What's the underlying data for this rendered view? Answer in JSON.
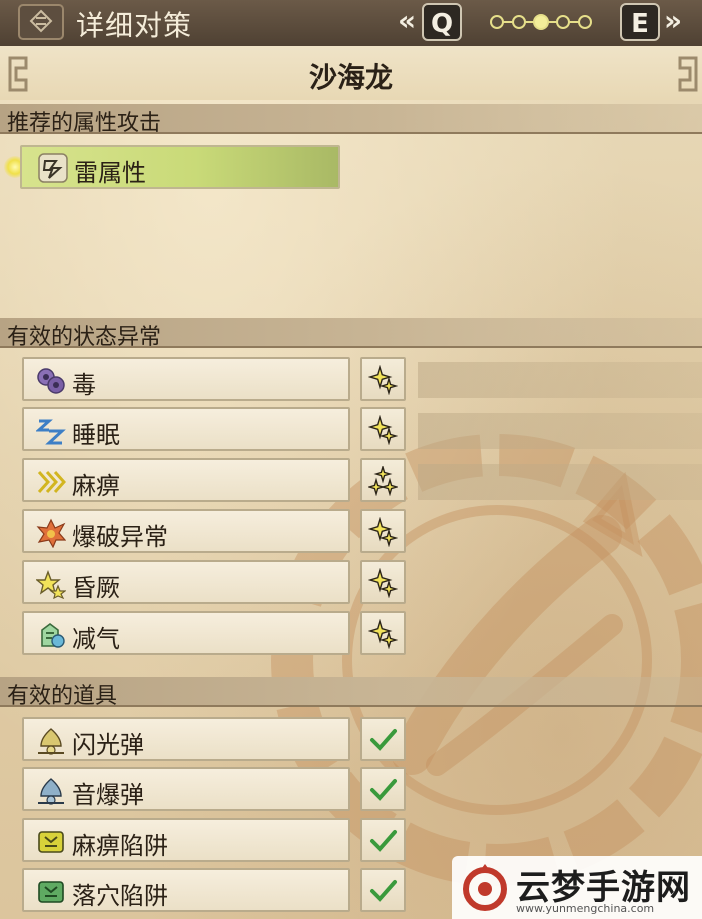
{
  "header": {
    "title": "详细对策",
    "prev_key": "Q",
    "next_key": "E",
    "prev_chevron": "«",
    "next_chevron": "»",
    "page_dots": {
      "count": 5,
      "active_index": 2
    }
  },
  "monster_name": "沙海龙",
  "recommended": {
    "section_title": "推荐的属性攻击",
    "items": [
      {
        "label": "雷属性",
        "icon": "thunder-element-icon"
      }
    ]
  },
  "ailments": {
    "section_title": "有效的状态异常",
    "items": [
      {
        "label": "毒",
        "icon": "poison-icon",
        "rating": 2
      },
      {
        "label": "睡眠",
        "icon": "sleep-icon",
        "rating": 2
      },
      {
        "label": "麻痹",
        "icon": "paralysis-icon",
        "rating": 3
      },
      {
        "label": "爆破异常",
        "icon": "blast-icon",
        "rating": 2
      },
      {
        "label": "昏厥",
        "icon": "stun-icon",
        "rating": 2
      },
      {
        "label": "减气",
        "icon": "exhaust-icon",
        "rating": 2
      }
    ]
  },
  "items_section": {
    "section_title": "有效的道具",
    "items": [
      {
        "label": "闪光弹",
        "icon": "flash-pod-icon",
        "effective": true
      },
      {
        "label": "音爆弹",
        "icon": "sonic-bomb-icon",
        "effective": true,
        "marked": "*"
      },
      {
        "label": "麻痹陷阱",
        "icon": "shock-trap-icon",
        "effective": true
      },
      {
        "label": "落穴陷阱",
        "icon": "pitfall-trap-icon",
        "effective": true
      }
    ]
  },
  "watermark": {
    "name": "云梦手游网",
    "url": "www.yunmengchina.com"
  },
  "colors": {
    "element_highlight": "#d7e38d",
    "check": "#3a9a3c",
    "star_fill": "#f2e35a"
  }
}
